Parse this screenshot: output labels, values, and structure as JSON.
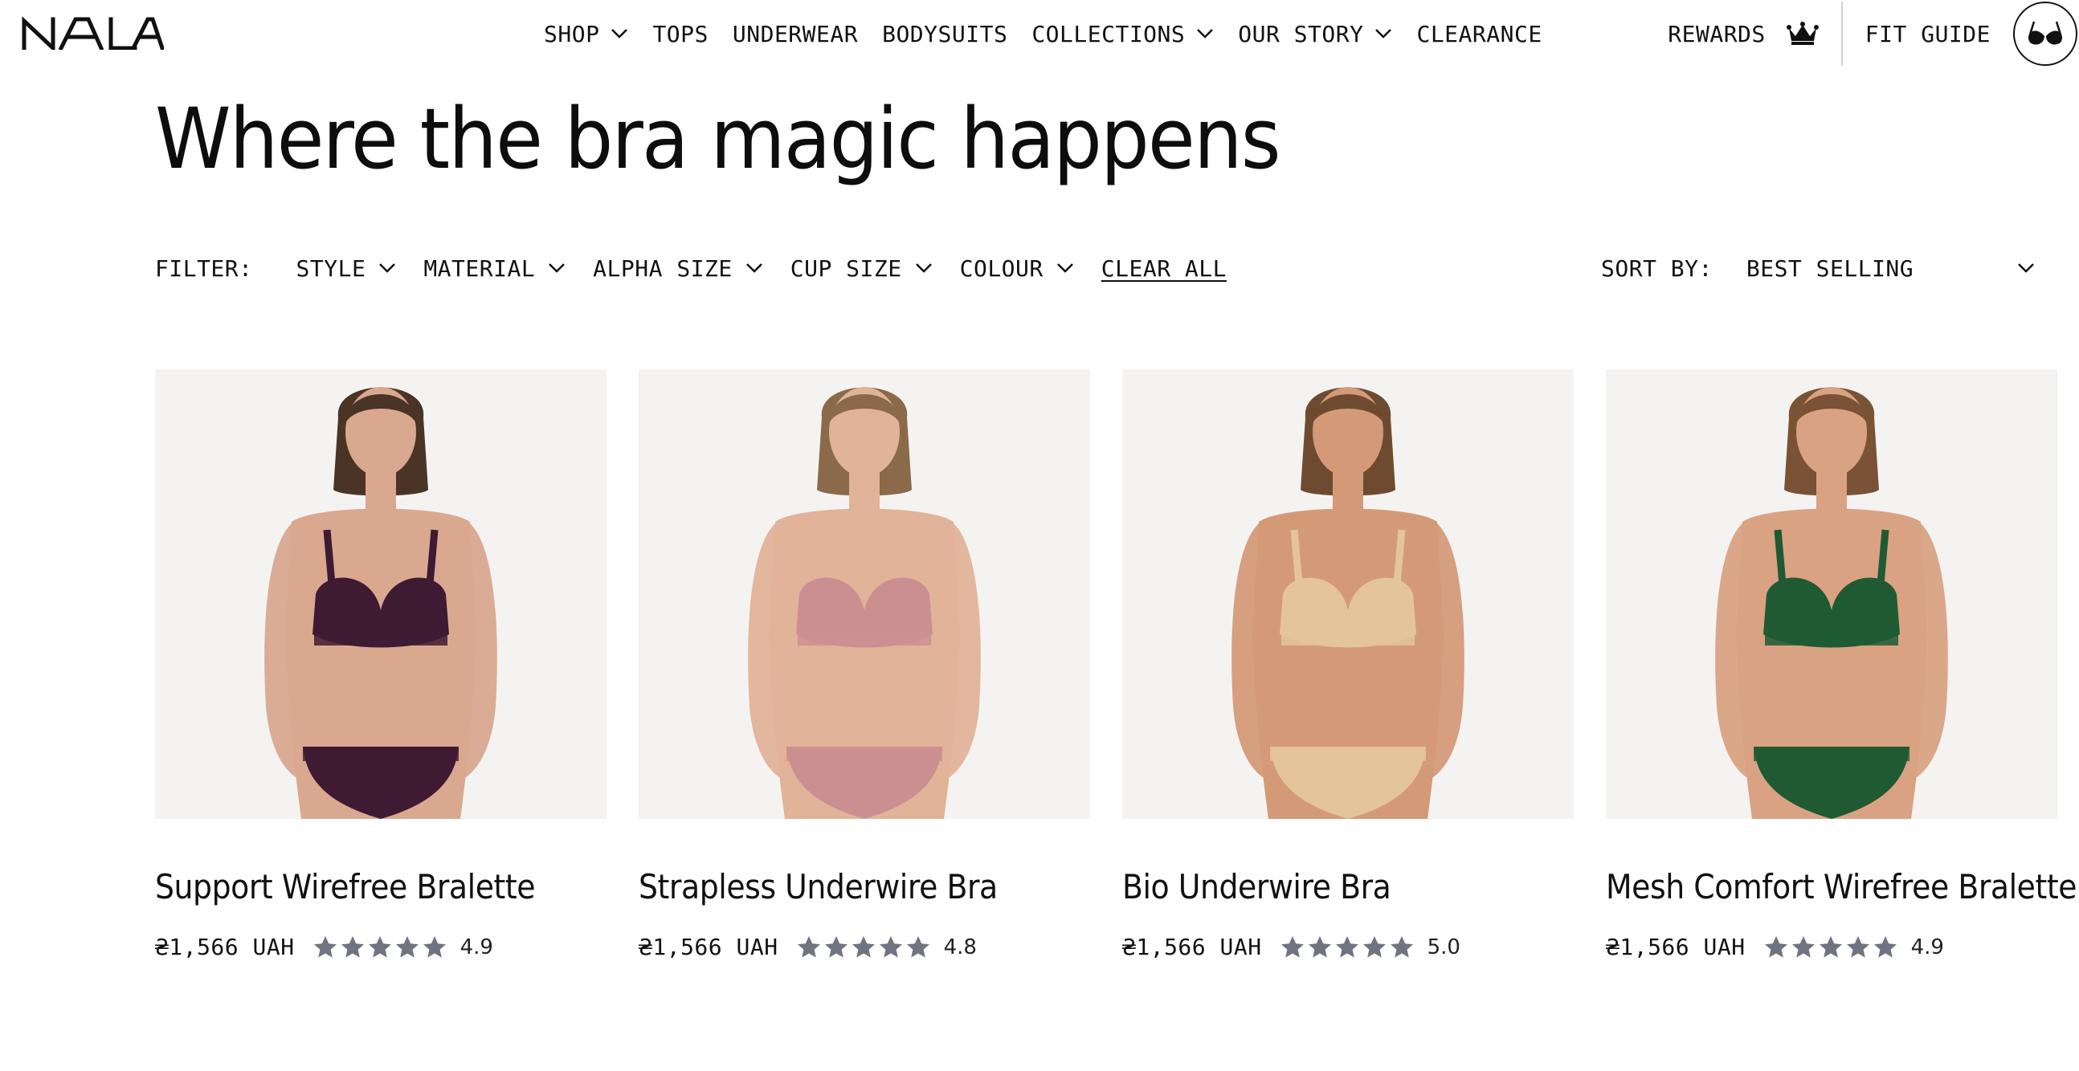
{
  "brand": {
    "logo_text": "NALA"
  },
  "nav": {
    "items": [
      {
        "label": "SHOP",
        "has_dropdown": true
      },
      {
        "label": "TOPS",
        "has_dropdown": false
      },
      {
        "label": "UNDERWEAR",
        "has_dropdown": false
      },
      {
        "label": "BODYSUITS",
        "has_dropdown": false
      },
      {
        "label": "COLLECTIONS",
        "has_dropdown": true
      },
      {
        "label": "OUR STORY",
        "has_dropdown": true
      },
      {
        "label": "CLEARANCE",
        "has_dropdown": false
      }
    ],
    "rewards_label": "REWARDS",
    "fit_guide_label": "FIT GUIDE"
  },
  "page": {
    "title": "Where the bra magic happens"
  },
  "filters": {
    "label": "FILTER:",
    "items": [
      {
        "label": "STYLE"
      },
      {
        "label": "MATERIAL"
      },
      {
        "label": "ALPHA SIZE"
      },
      {
        "label": "CUP SIZE"
      },
      {
        "label": "COLOUR"
      }
    ],
    "clear_all": "CLEAR ALL"
  },
  "sort": {
    "label": "SORT BY:",
    "value": "BEST SELLING"
  },
  "products": [
    {
      "name": "Support Wirefree Bralette",
      "price": "₴1,566 UAH",
      "rating": "4.9",
      "stars": 5,
      "garment_color": "#3e1b33",
      "skin_color": "#d9a88f",
      "hair_color": "#4a3426"
    },
    {
      "name": "Strapless Underwire Bra",
      "price": "₴1,566 UAH",
      "rating": "4.8",
      "stars": 5,
      "garment_color": "#cc8f91",
      "skin_color": "#e1b398",
      "hair_color": "#8a6a48"
    },
    {
      "name": "Bio Underwire Bra",
      "price": "₴1,566 UAH",
      "rating": "5.0",
      "stars": 5,
      "garment_color": "#e4c49a",
      "skin_color": "#d49a78",
      "hair_color": "#6e4b30"
    },
    {
      "name": "Mesh Comfort Wirefree Bralette",
      "price": "₴1,566 UAH",
      "rating": "4.9",
      "stars": 5,
      "garment_color": "#1f5a33",
      "skin_color": "#d9a283",
      "hair_color": "#7a5236"
    }
  ],
  "colors": {
    "star": "#6f7480",
    "text": "#111111",
    "image_bg": "#f4f3f2"
  }
}
